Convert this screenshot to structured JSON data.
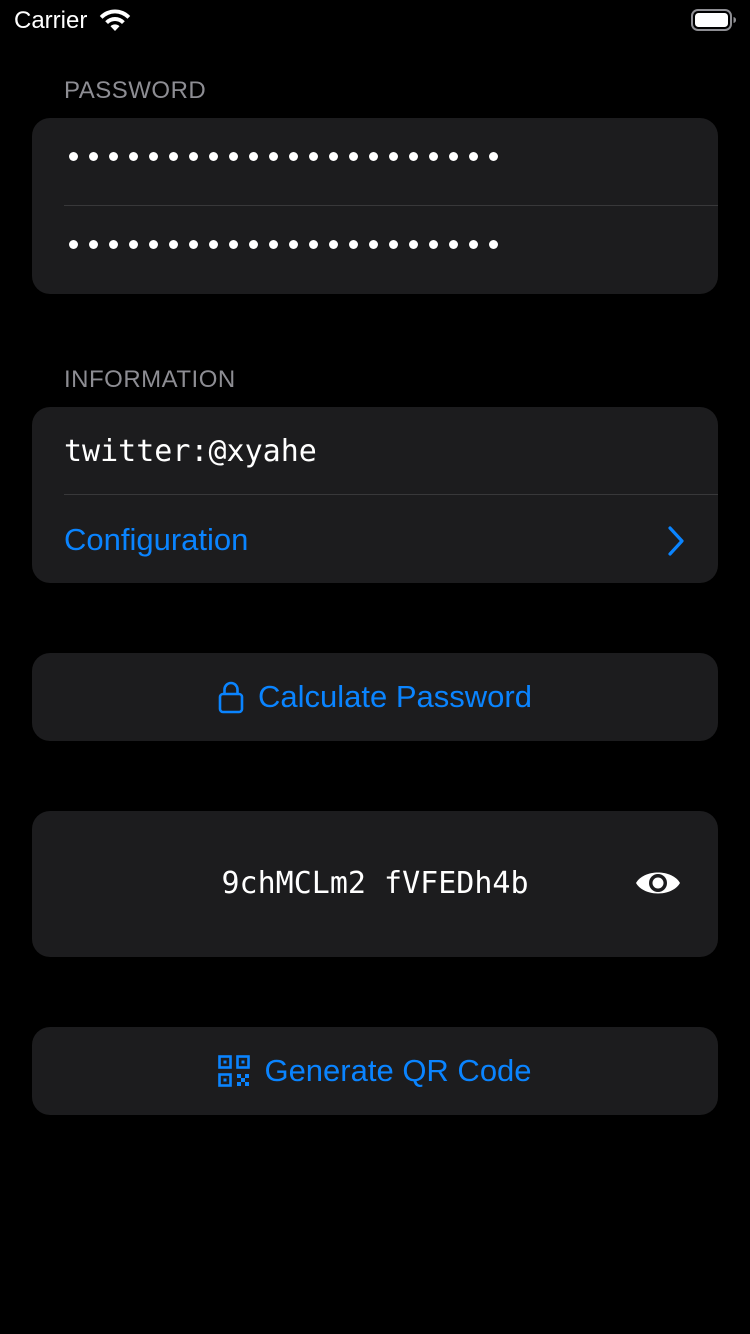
{
  "status_bar": {
    "carrier": "Carrier",
    "wifi_icon": "wifi-icon",
    "battery_icon": "battery-icon"
  },
  "password_section": {
    "header": "PASSWORD",
    "field1_masked_length": 22,
    "field2_masked_length": 22
  },
  "information_section": {
    "header": "INFORMATION",
    "info_value": "twitter:@xyahe",
    "configuration_label": "Configuration",
    "configuration_icon": "chevron-right-icon"
  },
  "calculate_button": {
    "label": "Calculate Password",
    "icon": "lock-icon"
  },
  "result": {
    "password": "9chMCLm2 fVFEDh4b",
    "toggle_icon": "eye-icon"
  },
  "qr_button": {
    "label": "Generate QR Code",
    "icon": "qrcode-icon"
  },
  "colors": {
    "background": "#000000",
    "card": "#1c1c1e",
    "accent": "#0a84ff",
    "secondary_text": "#8d8d93",
    "separator": "#38383a"
  }
}
